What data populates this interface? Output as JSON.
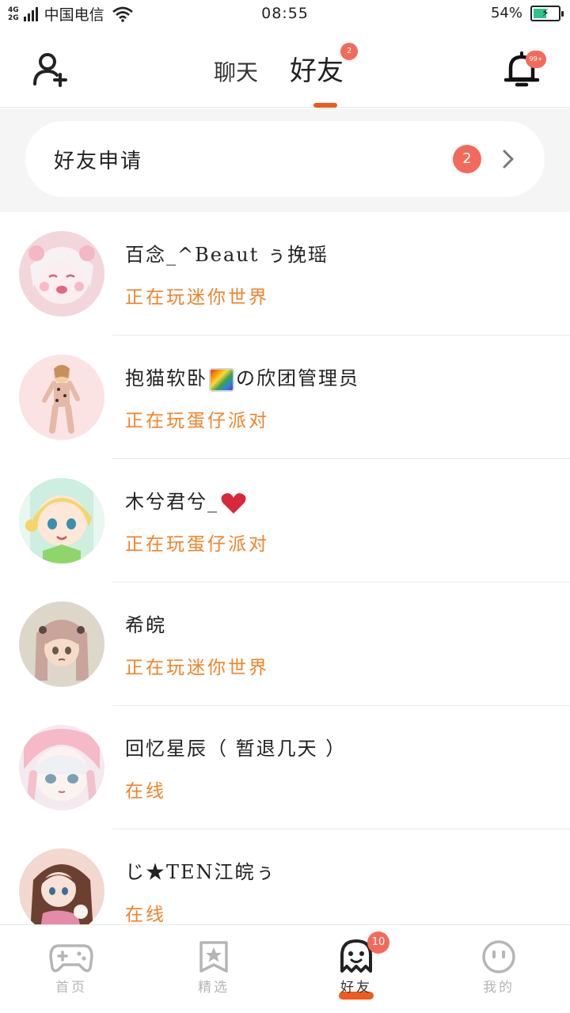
{
  "status_bar": {
    "network_types": [
      "4G",
      "2G"
    ],
    "carrier": "中国电信",
    "time": "08:55",
    "battery_percent": "54%",
    "battery_level": 0.54
  },
  "header": {
    "tabs": [
      {
        "label": "聊天",
        "active": false
      },
      {
        "label": "好友",
        "active": true,
        "badge": "2"
      }
    ],
    "bell_badge": "99+",
    "accent_color": "#f05a1f"
  },
  "friend_requests": {
    "label": "好友申请",
    "count": "2"
  },
  "friends": [
    {
      "name": "百念_^Beaut ぅ挽瑶",
      "status": "正在玩迷你世界",
      "avatar": "anime-girl-pink-hair"
    },
    {
      "name_before": "抱猫软卧",
      "emoji": "rainbow-emoji",
      "name_after": "の欣团管理员",
      "status": "正在玩蛋仔派对",
      "avatar": "chibi-figure"
    },
    {
      "name": "木兮君兮_",
      "emoji": "heart-emoji",
      "status": "正在玩蛋仔派对",
      "avatar": "anime-girl-blonde"
    },
    {
      "name": "希皖",
      "status": "正在玩迷你世界",
      "avatar": "anime-girl-pigtails"
    },
    {
      "name": "回忆星辰（ 暂退几天 ）",
      "status": "在线",
      "avatar": "anime-girl-white-hair"
    },
    {
      "name": "じ★TEN江皖ぅ",
      "status": "在线",
      "avatar": "anime-girl-brown-hair"
    }
  ],
  "bottom_nav": [
    {
      "label": "首页",
      "icon": "gamepad-icon",
      "active": false
    },
    {
      "label": "精选",
      "icon": "star-icon",
      "active": false
    },
    {
      "label": "好友",
      "icon": "ghost-icon",
      "active": true,
      "badge": "10"
    },
    {
      "label": "我的",
      "icon": "smiley-icon",
      "active": false
    }
  ]
}
